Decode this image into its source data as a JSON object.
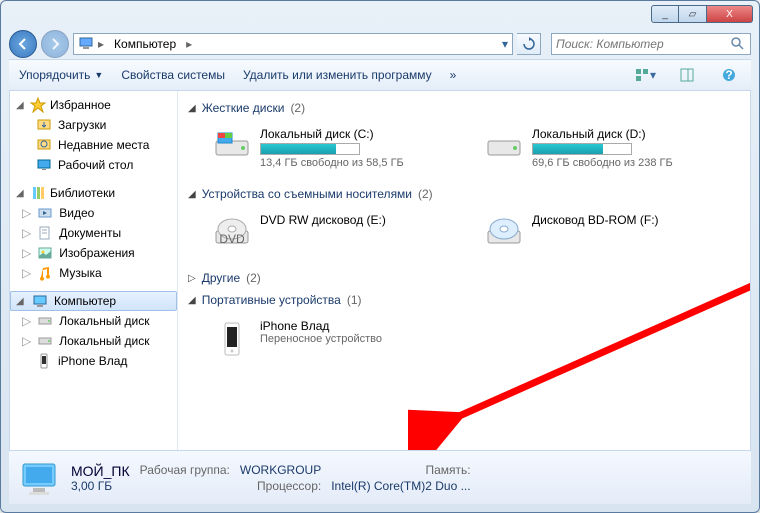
{
  "titlebar": {
    "min": "_",
    "max": "▱",
    "close": "X"
  },
  "nav": {
    "breadcrumb_root_icon": "computer",
    "breadcrumb": "Компьютер",
    "search_placeholder": "Поиск: Компьютер"
  },
  "toolbar": {
    "organize": "Упорядочить",
    "properties": "Свойства системы",
    "uninstall": "Удалить или изменить программу",
    "overflow": "»"
  },
  "sidebar": {
    "favorites": {
      "label": "Избранное",
      "items": [
        {
          "icon": "download",
          "label": "Загрузки"
        },
        {
          "icon": "recent",
          "label": "Недавние места"
        },
        {
          "icon": "desktop",
          "label": "Рабочий стол"
        }
      ]
    },
    "libraries": {
      "label": "Библиотеки",
      "items": [
        {
          "icon": "video",
          "label": "Видео"
        },
        {
          "icon": "docs",
          "label": "Документы"
        },
        {
          "icon": "pics",
          "label": "Изображения"
        },
        {
          "icon": "music",
          "label": "Музыка"
        }
      ]
    },
    "computer": {
      "label": "Компьютер",
      "items": [
        {
          "icon": "drive",
          "label": "Локальный диск"
        },
        {
          "icon": "drive",
          "label": "Локальный диск"
        },
        {
          "icon": "phone",
          "label": "iPhone Влад"
        }
      ]
    }
  },
  "content": {
    "hard_drives": {
      "label": "Жесткие диски",
      "count": "(2)",
      "items": [
        {
          "name": "Локальный диск (C:)",
          "sub": "13,4 ГБ свободно из 58,5 ГБ",
          "fill_pct": 77
        },
        {
          "name": "Локальный диск (D:)",
          "sub": "69,6 ГБ свободно из 238 ГБ",
          "fill_pct": 71
        }
      ]
    },
    "removable": {
      "label": "Устройства со съемными носителями",
      "count": "(2)",
      "items": [
        {
          "name": "DVD RW дисковод (E:)",
          "icon": "dvd"
        },
        {
          "name": "Дисковод BD-ROM (F:)",
          "icon": "bd"
        }
      ]
    },
    "other": {
      "label": "Другие",
      "count": "(2)"
    },
    "portable": {
      "label": "Портативные устройства",
      "count": "(1)",
      "items": [
        {
          "name": "iPhone Влад",
          "sub": "Переносное устройство",
          "icon": "phone"
        }
      ]
    }
  },
  "details": {
    "name": "МОЙ_ПК",
    "workgroup_label": "Рабочая группа:",
    "workgroup": "WORKGROUP",
    "memory_label": "Память:",
    "memory": "3,00 ГБ",
    "cpu_label": "Процессор:",
    "cpu": "Intel(R) Core(TM)2 Duo ..."
  }
}
